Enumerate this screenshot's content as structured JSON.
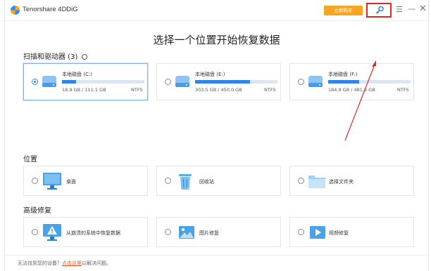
{
  "app": {
    "title": "Tenorshare 4DDiG",
    "buy_label": "立即购买"
  },
  "heading": "选择一个位置开始恢复数据",
  "scan_section": {
    "label": "扫描和驱动器 (3)"
  },
  "drives": [
    {
      "name": "本地磁盘 (C:)",
      "size": "18.9 GB / 111.1 GB",
      "fs": "NTFS",
      "used_fraction": 0.17,
      "selected": true
    },
    {
      "name": "本地磁盘 (E:)",
      "size": "303.5 GB / 450.0 GB",
      "fs": "NTFS",
      "used_fraction": 0.67,
      "selected": false
    },
    {
      "name": "本地磁盘 (F:)",
      "size": "184.9 GB / 481.5 GB",
      "fs": "NTFS",
      "used_fraction": 0.38,
      "selected": false
    }
  ],
  "location_section": {
    "label": "位置"
  },
  "locations": [
    {
      "label": "桌面",
      "icon": "desktop-icon"
    },
    {
      "label": "回收站",
      "icon": "recycle-bin-icon"
    },
    {
      "label": "选择文件夹",
      "icon": "folder-icon"
    }
  ],
  "advanced_section": {
    "label": "高级修复"
  },
  "advanced": [
    {
      "label": "从崩溃的系统中恢复数据",
      "icon": "crashed-system-icon"
    },
    {
      "label": "图片修复",
      "icon": "image-repair-icon"
    },
    {
      "label": "视频修复",
      "icon": "video-repair-icon"
    }
  ],
  "footer": {
    "text": "无法找到您的设备？",
    "link": "点击这里",
    "suffix": "以解决问题。"
  },
  "colors": {
    "accent": "#2f86e6",
    "buy": "#f5a623",
    "highlight": "#d9262b"
  }
}
